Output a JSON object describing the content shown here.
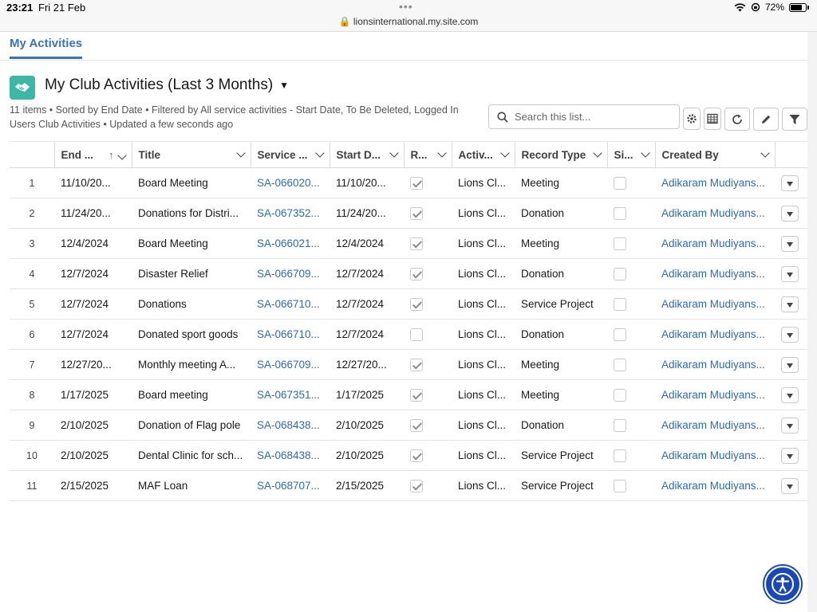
{
  "status_bar": {
    "time": "23:21",
    "date": "Fri 21 Feb",
    "url": "lionsinternational.my.site.com",
    "battery": "72%"
  },
  "tab": {
    "label": "My Activities"
  },
  "list_view": {
    "title": "My Club Activities (Last 3 Months)",
    "meta": "11 items • Sorted by End Date • Filtered by All service activities - Start Date, To Be Deleted, Logged In Users Club Activities • Updated a few seconds ago",
    "search_placeholder": "Search this list...",
    "icon_color": "#3db8a4"
  },
  "columns": [
    "End ...",
    "Title",
    "Service ...",
    "Start D...",
    "R...",
    "Activ...",
    "Record Type",
    "Si...",
    "Created By"
  ],
  "rows": [
    {
      "n": "1",
      "end": "11/10/20...",
      "title": "Board Meeting",
      "service": "SA-066020...",
      "start": "11/10/20...",
      "r": true,
      "activ": "Lions Cl...",
      "record_type": "Meeting",
      "si": false,
      "created_by": "Adikaram Mudiyans..."
    },
    {
      "n": "2",
      "end": "11/24/20...",
      "title": "Donations for Distri...",
      "service": "SA-067352...",
      "start": "11/24/20...",
      "r": true,
      "activ": "Lions Cl...",
      "record_type": "Donation",
      "si": false,
      "created_by": "Adikaram Mudiyans..."
    },
    {
      "n": "3",
      "end": "12/4/2024",
      "title": "Board Meeting",
      "service": "SA-066021...",
      "start": "12/4/2024",
      "r": true,
      "activ": "Lions Cl...",
      "record_type": "Meeting",
      "si": false,
      "created_by": "Adikaram Mudiyans..."
    },
    {
      "n": "4",
      "end": "12/7/2024",
      "title": "Disaster Relief",
      "service": "SA-066709...",
      "start": "12/7/2024",
      "r": true,
      "activ": "Lions Cl...",
      "record_type": "Donation",
      "si": false,
      "created_by": "Adikaram Mudiyans..."
    },
    {
      "n": "5",
      "end": "12/7/2024",
      "title": "Donations",
      "service": "SA-066710...",
      "start": "12/7/2024",
      "r": true,
      "activ": "Lions Cl...",
      "record_type": "Service Project",
      "si": false,
      "created_by": "Adikaram Mudiyans..."
    },
    {
      "n": "6",
      "end": "12/7/2024",
      "title": "Donated sport goods",
      "service": "SA-066710...",
      "start": "12/7/2024",
      "r": false,
      "activ": "Lions Cl...",
      "record_type": "Donation",
      "si": false,
      "created_by": "Adikaram Mudiyans..."
    },
    {
      "n": "7",
      "end": "12/27/20...",
      "title": "Monthly meeting A...",
      "service": "SA-066709...",
      "start": "12/27/20...",
      "r": true,
      "activ": "Lions Cl...",
      "record_type": "Meeting",
      "si": false,
      "created_by": "Adikaram Mudiyans..."
    },
    {
      "n": "8",
      "end": "1/17/2025",
      "title": "Board meeting",
      "service": "SA-067351...",
      "start": "1/17/2025",
      "r": true,
      "activ": "Lions Cl...",
      "record_type": "Meeting",
      "si": false,
      "created_by": "Adikaram Mudiyans..."
    },
    {
      "n": "9",
      "end": "2/10/2025",
      "title": "Donation of Flag pole",
      "service": "SA-068438...",
      "start": "2/10/2025",
      "r": true,
      "activ": "Lions Cl...",
      "record_type": "Donation",
      "si": false,
      "created_by": "Adikaram Mudiyans..."
    },
    {
      "n": "10",
      "end": "2/10/2025",
      "title": "Dental Clinic for sch...",
      "service": "SA-068438...",
      "start": "2/10/2025",
      "r": true,
      "activ": "Lions Cl...",
      "record_type": "Service Project",
      "si": false,
      "created_by": "Adikaram Mudiyans..."
    },
    {
      "n": "11",
      "end": "2/15/2025",
      "title": "MAF Loan",
      "service": "SA-068707...",
      "start": "2/15/2025",
      "r": true,
      "activ": "Lions Cl...",
      "record_type": "Service Project",
      "si": false,
      "created_by": "Adikaram Mudiyans..."
    }
  ],
  "colors": {
    "accent": "#3a73b8",
    "link": "#2f6bb3",
    "a11y": "#1a47b8"
  }
}
